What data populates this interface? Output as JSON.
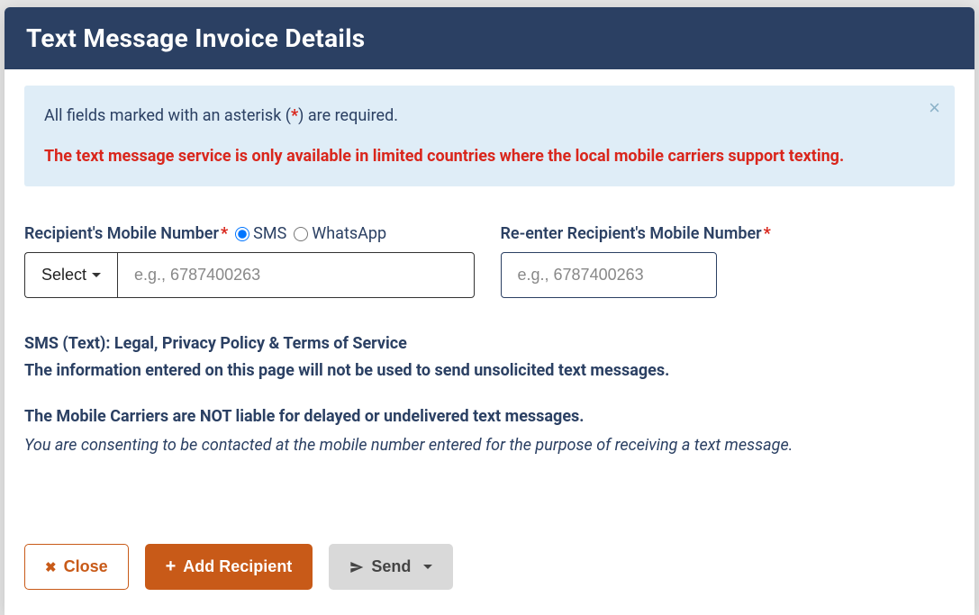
{
  "modal": {
    "title": "Text Message Invoice Details"
  },
  "alert": {
    "line1_pre": "All fields marked with an asterisk (",
    "asterisk": "*",
    "line1_post": ") are required.",
    "line2": "The text message service is only available in limited countries where the local mobile carriers support texting."
  },
  "form": {
    "mobile_label": "Recipient's Mobile Number",
    "sms_label": "SMS",
    "whatsapp_label": "WhatsApp",
    "select_label": "Select",
    "mobile_placeholder": "e.g., 6787400263",
    "reenter_label": "Re-enter Recipient's Mobile Number",
    "reenter_placeholder": "e.g., 6787400263",
    "channel": "sms"
  },
  "legal": {
    "title": "SMS (Text): Legal, Privacy Policy & Terms of Service",
    "line1": "The information entered on this page will not be used to send unsolicited text messages.",
    "line2": "The Mobile Carriers are NOT liable for delayed or undelivered text messages.",
    "line3": "You are consenting to be contacted at the mobile number entered for the purpose of receiving a text message."
  },
  "footer": {
    "close": "Close",
    "add": "Add Recipient",
    "send": "Send"
  }
}
